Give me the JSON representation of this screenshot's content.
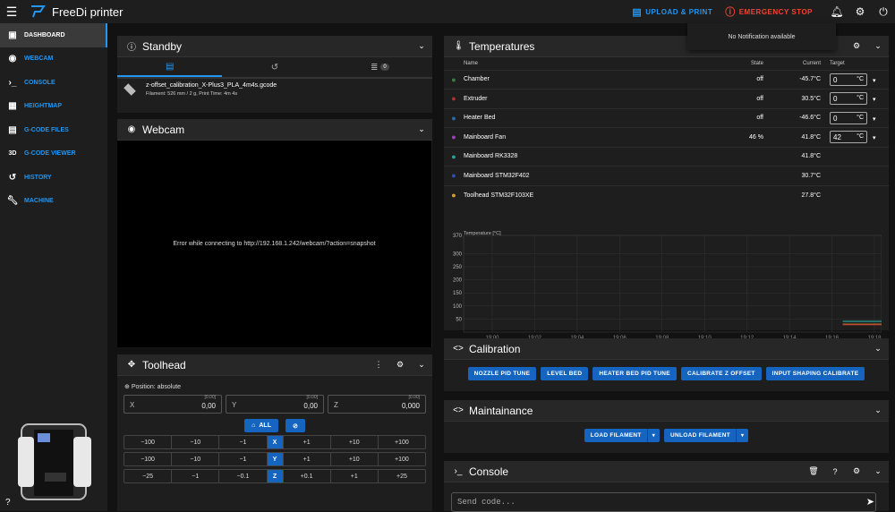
{
  "app": {
    "title": "FreeDi printer"
  },
  "topbar": {
    "upload_label": "UPLOAD & PRINT",
    "emergency_label": "EMERGENCY STOP",
    "notification_text": "No Notification available"
  },
  "sidebar": {
    "items": [
      {
        "label": "DASHBOARD",
        "icon": "dashboard-icon"
      },
      {
        "label": "WEBCAM",
        "icon": "webcam-icon"
      },
      {
        "label": "CONSOLE",
        "icon": "console-icon"
      },
      {
        "label": "HEIGHTMAP",
        "icon": "grid-icon"
      },
      {
        "label": "G-CODE FILES",
        "icon": "file-icon"
      },
      {
        "label": "G-CODE VIEWER",
        "icon": "3d-icon"
      },
      {
        "label": "HISTORY",
        "icon": "history-icon"
      },
      {
        "label": "MACHINE",
        "icon": "wrench-icon"
      }
    ],
    "viewer_icon_text": "3D"
  },
  "standby": {
    "title": "Standby",
    "queue_count": "0",
    "file_name": "z-offset_calibration_X-Plus3_PLA_4m4s.gcode",
    "file_meta": "Filament: 526 mm / 2 g, Print Time: 4m 4s"
  },
  "webcam": {
    "title": "Webcam",
    "error": "Error while connecting to http://192.168.1.242/webcam/?action=snapshot"
  },
  "toolhead": {
    "title": "Toolhead",
    "position_label": "Position: absolute",
    "x": {
      "label": "X",
      "max": "[0.00]",
      "value": "0,00"
    },
    "y": {
      "label": "Y",
      "max": "[0.00]",
      "value": "0,00"
    },
    "z": {
      "label": "Z",
      "max": "[0.00]",
      "value": "0,000"
    },
    "home_all": "ALL",
    "jog_x": [
      "−100",
      "−10",
      "−1",
      "X",
      "+1",
      "+10",
      "+100"
    ],
    "jog_y": [
      "−100",
      "−10",
      "−1",
      "Y",
      "+1",
      "+10",
      "+100"
    ],
    "jog_z": [
      "−25",
      "−1",
      "−0.1",
      "Z",
      "+0.1",
      "+1",
      "+25"
    ]
  },
  "temperatures": {
    "title": "Temperatures",
    "headers": {
      "name": "Name",
      "state": "State",
      "current": "Current",
      "target": "Target"
    },
    "rows": [
      {
        "name": "Chamber",
        "state": "off",
        "current": "-45.7°C",
        "target": "0",
        "unit": "°C",
        "color": "#3a7d44"
      },
      {
        "name": "Extruder",
        "state": "off",
        "current": "30.5°C",
        "target": "0",
        "unit": "°C",
        "color": "#b03030"
      },
      {
        "name": "Heater Bed",
        "state": "off",
        "current": "-46.6°C",
        "target": "0",
        "unit": "°C",
        "color": "#2d6bb0"
      },
      {
        "name": "Mainboard Fan",
        "state": "46 %",
        "current": "41.8°C",
        "target": "42",
        "unit": "°C",
        "color": "#a040c0"
      },
      {
        "name": "Mainboard RK3328",
        "state": "",
        "current": "41.8°C",
        "target": "",
        "unit": "",
        "color": "#2aa198"
      },
      {
        "name": "Mainboard STM32F402",
        "state": "",
        "current": "30.7°C",
        "target": "",
        "unit": "",
        "color": "#3050c0"
      },
      {
        "name": "Toolhead STM32F103XE",
        "state": "",
        "current": "27.8°C",
        "target": "",
        "unit": "",
        "color": "#d4a030"
      }
    ]
  },
  "chart_data": {
    "type": "line",
    "title": "",
    "ylabel": "Temperature [°C]",
    "ylim": [
      0,
      370
    ],
    "yticks": [
      370,
      300,
      250,
      200,
      150,
      100,
      50
    ],
    "x": [
      "19:00",
      "19:02",
      "19:04",
      "19:06",
      "19:08",
      "19:10",
      "19:12",
      "19:14",
      "19:16",
      "19:18"
    ],
    "series": [
      {
        "color": "#2aa198",
        "values": [
          41,
          41
        ]
      },
      {
        "color": "#d4a030",
        "values": [
          30,
          30
        ]
      },
      {
        "color": "#b03030",
        "values": [
          28,
          28
        ]
      }
    ]
  },
  "calibration": {
    "title": "Calibration",
    "buttons": [
      "NOZZLE PID TUNE",
      "LEVEL BED",
      "HEATER BED PID TUNE",
      "CALIBRATE Z OFFSET",
      "INPUT SHAPING CALIBRATE"
    ]
  },
  "maintainance": {
    "title": "Maintainance",
    "load": "LOAD FILAMENT",
    "unload": "UNLOAD FILAMENT"
  },
  "console": {
    "title": "Console",
    "placeholder": "Send code..."
  }
}
